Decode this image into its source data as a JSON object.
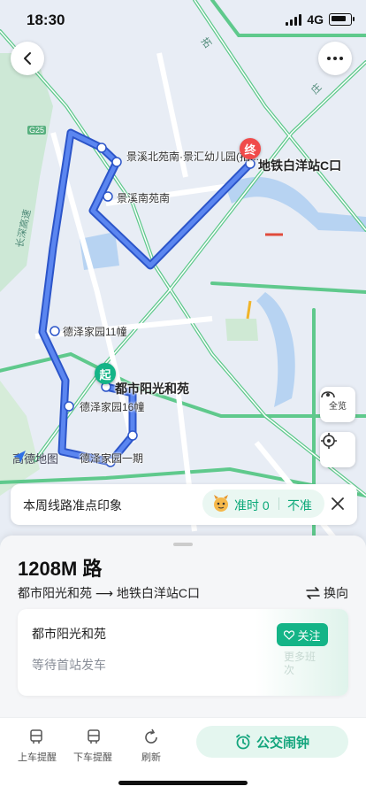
{
  "status_bar": {
    "time": "18:30",
    "network": "4G"
  },
  "map": {
    "start_marker": "起",
    "end_marker": "终",
    "stops": [
      {
        "name": "都市阳光和苑",
        "role": "start"
      },
      {
        "name": "德泽家园16幢"
      },
      {
        "name": "德泽家园一期"
      },
      {
        "name": "德泽家园11幢"
      },
      {
        "name": "景溪北苑南·景汇幼儿园(招..."
      },
      {
        "name": "景溪南苑南"
      },
      {
        "name": "地铁白洋站C口",
        "role": "end"
      }
    ],
    "road_labels": [
      "拓",
      "庄",
      "长深高速",
      "G25"
    ],
    "watermark": "高德地图",
    "panorama_label": "全览"
  },
  "rating": {
    "title": "本周线路准点印象",
    "on_time": "准时 0",
    "late": "不准"
  },
  "route": {
    "name": "1208M 路",
    "from": "都市阳光和苑",
    "to": "地铁白洋站C口",
    "swap_label": "换向",
    "current_stop": "都市阳光和苑",
    "status": "等待首站发车",
    "follow_label": "关注",
    "more_times_label": "更多班次"
  },
  "toolbar": {
    "board_alert": "上车提醒",
    "alight_alert": "下车提醒",
    "refresh": "刷新",
    "alarm": "公交闹钟"
  },
  "colors": {
    "accent": "#14b487",
    "route": "#3b6de6",
    "end_marker": "#f04a4a"
  }
}
